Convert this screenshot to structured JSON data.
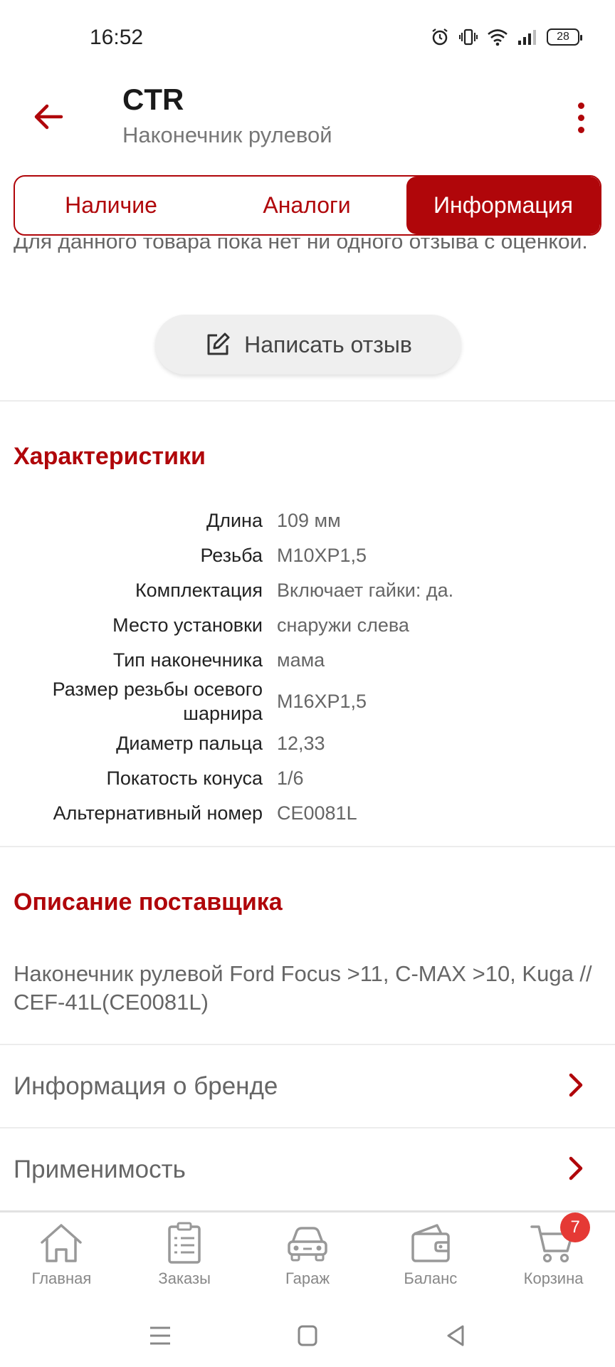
{
  "status_bar": {
    "time": "16:52",
    "battery": "28",
    "icons": [
      "alarm-icon",
      "vibrate-icon",
      "wifi-icon",
      "signal-icon",
      "battery-icon"
    ]
  },
  "header": {
    "title": "CTR",
    "subtitle": "Наконечник рулевой"
  },
  "tabs": [
    {
      "label": "Наличие",
      "active": false
    },
    {
      "label": "Аналоги",
      "active": false
    },
    {
      "label": "Информация",
      "active": true
    }
  ],
  "reviews": {
    "note": "Для данного товара пока нет ни одного отзыва с оценкой.",
    "write_button": "Написать отзыв"
  },
  "characteristics": {
    "title": "Характеристики",
    "rows": [
      {
        "key": "Длина",
        "value": "109 мм"
      },
      {
        "key": "Резьба",
        "value": "M10XP1,5"
      },
      {
        "key": "Комплектация",
        "value": "Включает гайки: да."
      },
      {
        "key": "Место установки",
        "value": "снаружи слева"
      },
      {
        "key": "Тип наконечника",
        "value": "мама"
      },
      {
        "key": "Размер резьбы осевого шарнира",
        "value": "M16XP1,5"
      },
      {
        "key": "Диаметр пальца",
        "value": "12,33"
      },
      {
        "key": "Покатость конуса",
        "value": "1/6"
      },
      {
        "key": "Альтернативный номер",
        "value": "CE0081L"
      }
    ]
  },
  "supplier": {
    "title": "Описание поставщика",
    "description": "Наконечник рулевой Ford Focus >11, C-MAX >10, Kuga // CEF-41L(CE0081L)"
  },
  "links": [
    {
      "label": "Информация о бренде"
    },
    {
      "label": "Применимость"
    }
  ],
  "bottom_nav": [
    {
      "label": "Главная",
      "icon": "home-icon"
    },
    {
      "label": "Заказы",
      "icon": "orders-icon"
    },
    {
      "label": "Гараж",
      "icon": "car-icon"
    },
    {
      "label": "Баланс",
      "icon": "wallet-icon"
    },
    {
      "label": "Корзина",
      "icon": "cart-icon",
      "badge": "7"
    }
  ],
  "colors": {
    "accent": "#b0060a",
    "badge": "#e53935",
    "muted_text": "#666666"
  }
}
